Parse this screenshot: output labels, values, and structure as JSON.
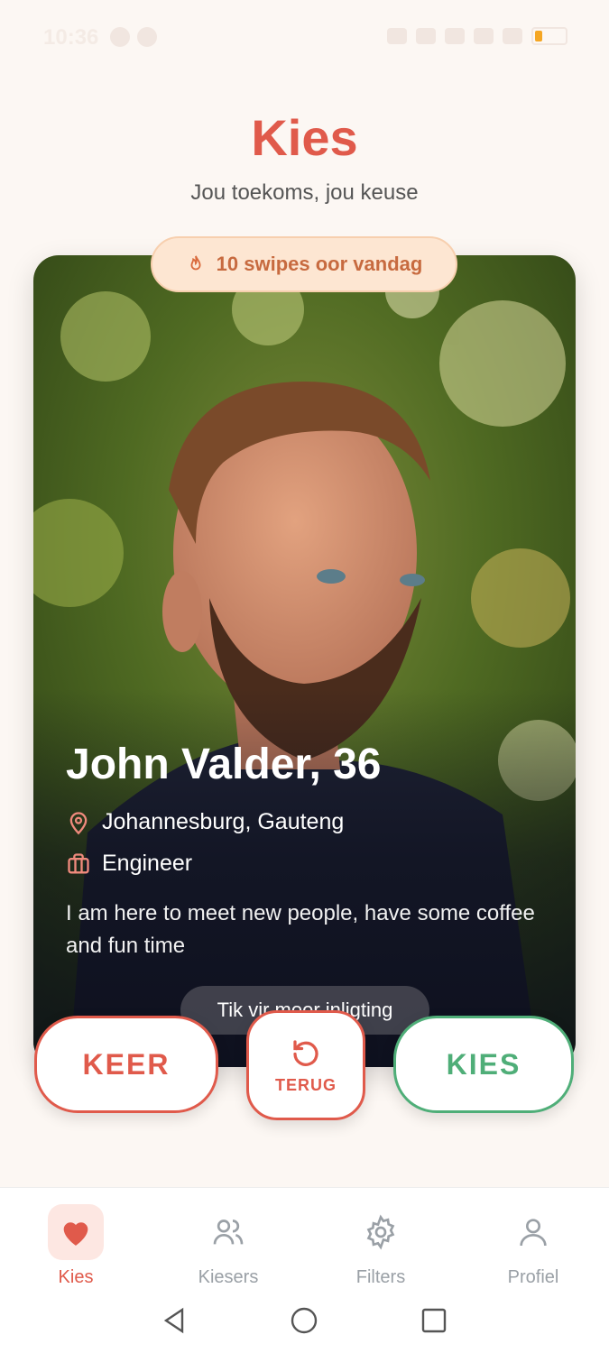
{
  "status_bar": {
    "time": "10:36"
  },
  "header": {
    "title": "Kies",
    "subtitle": "Jou toekoms, jou keuse"
  },
  "swipe_badge": {
    "icon": "flame-icon",
    "text": "10 swipes oor vandag"
  },
  "profile": {
    "name_age": "John Valder, 36",
    "location": "Johannesburg, Gauteng",
    "occupation": "Engineer",
    "bio": "I am here to meet new people, have some coffee and fun time",
    "more_info": "Tik vir meer inligting"
  },
  "actions": {
    "reject_label": "KEER",
    "undo_label": "TERUG",
    "like_label": "KIES"
  },
  "bottom_nav": {
    "items": [
      {
        "label": "Kies",
        "icon": "heart-icon",
        "active": true
      },
      {
        "label": "Kiesers",
        "icon": "users-icon",
        "active": false
      },
      {
        "label": "Filters",
        "icon": "gear-icon",
        "active": false
      },
      {
        "label": "Profiel",
        "icon": "person-icon",
        "active": false
      }
    ]
  },
  "colors": {
    "background": "#fcf7f3",
    "accent_red": "#e05a4b",
    "accent_green": "#4fae78",
    "badge_bg": "#fde6d2"
  }
}
